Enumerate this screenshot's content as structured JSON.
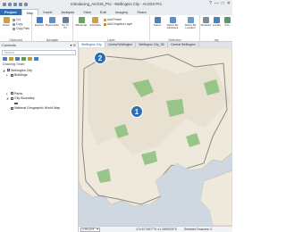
{
  "window": {
    "title": "Introducing_ArcGIS_Pro - Wellington City - ArcGIS Pro",
    "controls": [
      "?",
      "—",
      "□",
      "✕"
    ]
  },
  "ribbon_tabs": [
    "Project",
    "Map",
    "Insert",
    "Analysis",
    "View",
    "Edit",
    "Imagery",
    "Share"
  ],
  "ribbon": {
    "clipboard": {
      "label": "Clipboard",
      "paste": "Paste",
      "cut": "Cut",
      "copy": "Copy",
      "copy_path": "Copy Path"
    },
    "navigate": {
      "label": "Navigate",
      "explore": "Explore",
      "bookmarks": "Bookmarks",
      "go_to_xy": "Go To XY"
    },
    "layer": {
      "label": "Layer",
      "basemap": "Basemap",
      "add_data": "Add Data",
      "add_preset": "Add Preset",
      "add_graphics": "Add Graphics Layer"
    },
    "selection": {
      "label": "Selection",
      "select": "Select",
      "select_by_attributes": "Select By Attributes",
      "select_by_location": "Select By Location"
    },
    "inquiry": {
      "label": "Inq",
      "measure": "Measure",
      "locate": "Locate",
      "infographics": "Info"
    }
  },
  "contents": {
    "title": "Contents",
    "search_placeholder": "Search",
    "drawing_order": "Drawing Order",
    "layers": [
      {
        "name": "Wellington City",
        "checked": true,
        "expanded": true,
        "indent": 0
      },
      {
        "name": "Buildings",
        "checked": true,
        "expanded": false,
        "indent": 1
      },
      {
        "name": "Parks",
        "checked": true,
        "expanded": false,
        "indent": 1
      },
      {
        "name": "City Boundary",
        "checked": true,
        "expanded": true,
        "indent": 1
      },
      {
        "name": "National Geographic World Map",
        "checked": true,
        "expanded": false,
        "indent": 1
      }
    ]
  },
  "view_tabs": [
    "Wellington City",
    "Central Wellington",
    "Wellington City_3D",
    "Central Wellington"
  ],
  "status": {
    "scale": "1:90,224",
    "coordinates": "174.6774577°E 41.2890378°S",
    "selected": "Selected Features: 0"
  },
  "callouts": [
    "1",
    "2"
  ],
  "colors": {
    "accent": "#2f6db3",
    "water": "#cfd8e0",
    "land": "#efe9dc",
    "park": "#8bbf7a",
    "boundary": "#8a8a8a"
  }
}
